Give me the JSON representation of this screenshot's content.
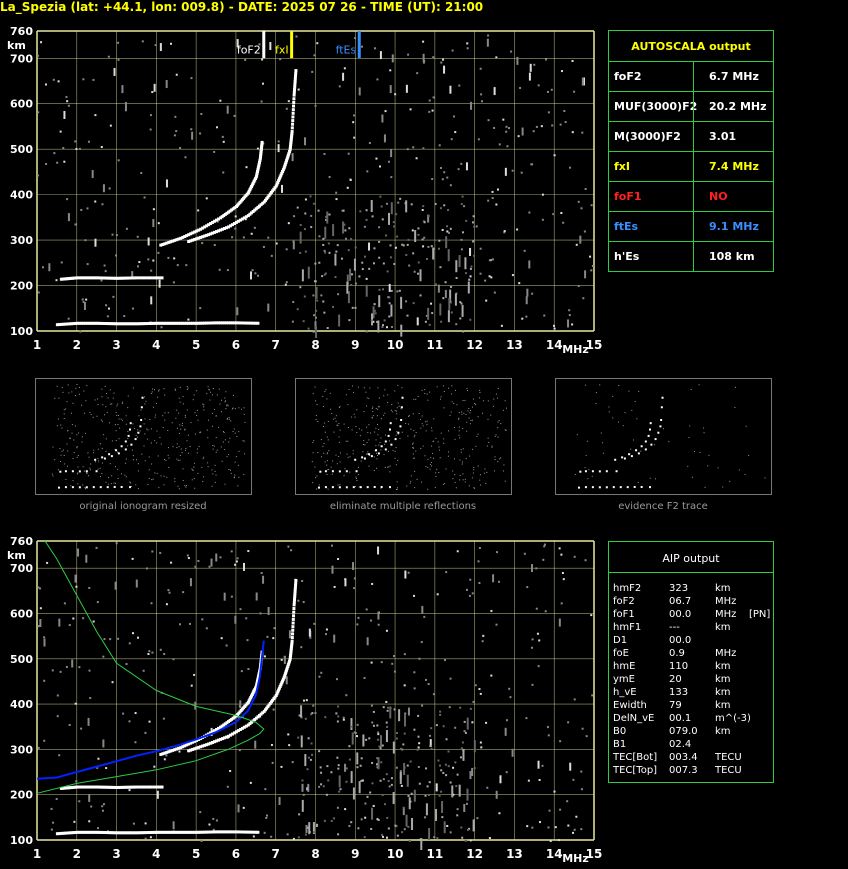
{
  "title": "La_Spezia (lat: +44.1, lon: 009.8) - DATE: 2025 07 26 - TIME (UT): 21:00",
  "colors": {
    "grid": "#e8e8a0",
    "axis": "#e8e8a0",
    "white": "#ffffff",
    "yellow": "#ffff00",
    "blue": "#3a8fff",
    "red": "#ff2020",
    "green": "#2ecc40",
    "profile": "#0022ff"
  },
  "chart_data": [
    {
      "type": "scatter",
      "title": "",
      "x_unit_label": "MHz",
      "y_unit_label": "km",
      "xlim": [
        1,
        15
      ],
      "ylim": [
        100,
        760
      ],
      "x_ticks": [
        1,
        2,
        3,
        4,
        5,
        6,
        7,
        8,
        9,
        10,
        11,
        12,
        13,
        14,
        15
      ],
      "y_ticks": [
        100,
        200,
        300,
        400,
        500,
        600,
        700,
        760
      ],
      "markers": [
        {
          "label": "foF2",
          "x": 6.7,
          "color": "#ffffff"
        },
        {
          "label": "fxI",
          "x": 7.4,
          "color": "#ffff00"
        },
        {
          "label": "ftEs",
          "x": 9.1,
          "color": "#3a8fff"
        }
      ],
      "traces": [
        {
          "name": "o-trace",
          "points": [
            [
              4.1,
              290
            ],
            [
              4.6,
              305
            ],
            [
              5.1,
              325
            ],
            [
              5.6,
              350
            ],
            [
              6.0,
              375
            ],
            [
              6.3,
              405
            ],
            [
              6.5,
              440
            ],
            [
              6.6,
              480
            ],
            [
              6.65,
              520
            ]
          ]
        },
        {
          "name": "x-trace",
          "points": [
            [
              4.8,
              298
            ],
            [
              5.3,
              313
            ],
            [
              5.8,
              330
            ],
            [
              6.3,
              355
            ],
            [
              6.7,
              385
            ],
            [
              7.0,
              420
            ],
            [
              7.2,
              460
            ],
            [
              7.35,
              500
            ],
            [
              7.4,
              540
            ],
            [
              7.45,
              620
            ],
            [
              7.5,
              680
            ]
          ]
        },
        {
          "name": "Es-layer",
          "points": [
            [
              1.5,
              115
            ],
            [
              2,
              118
            ],
            [
              2.5,
              118
            ],
            [
              3,
              117
            ],
            [
              3.5,
              117
            ],
            [
              4,
              118
            ],
            [
              4.5,
              118
            ],
            [
              5,
              118
            ],
            [
              5.5,
              119
            ],
            [
              6,
              119
            ],
            [
              6.6,
              118
            ]
          ]
        },
        {
          "name": "F-spread",
          "points": [
            [
              1.6,
              215
            ],
            [
              2,
              218
            ],
            [
              2.5,
              218
            ],
            [
              3,
              217
            ],
            [
              3.5,
              218
            ],
            [
              4.2,
              218
            ]
          ]
        }
      ]
    },
    {
      "type": "line",
      "title": "",
      "x_unit_label": "MHz",
      "y_unit_label": "km",
      "xlim": [
        1,
        15
      ],
      "ylim": [
        100,
        760
      ],
      "x_ticks": [
        1,
        2,
        3,
        4,
        5,
        6,
        7,
        8,
        9,
        10,
        11,
        12,
        13,
        14,
        15
      ],
      "y_ticks": [
        100,
        200,
        300,
        400,
        500,
        600,
        700,
        760
      ],
      "series": [
        {
          "name": "",
          "color": "#0022ff",
          "points": [
            [
              1,
              235
            ],
            [
              1.5,
              238
            ],
            [
              2,
              250
            ],
            [
              2.5,
              262
            ],
            [
              3,
              274
            ],
            [
              3.5,
              286
            ],
            [
              4,
              296
            ],
            [
              4.5,
              308
            ],
            [
              5,
              322
            ],
            [
              5.5,
              338
            ],
            [
              6,
              360
            ],
            [
              6.3,
              385
            ],
            [
              6.5,
              420
            ],
            [
              6.6,
              460
            ],
            [
              6.65,
              500
            ],
            [
              6.7,
              540
            ]
          ]
        },
        {
          "name": "",
          "color": "#2ecc40",
          "points": [
            [
              1.0,
              203
            ],
            [
              2,
              225
            ],
            [
              3,
              240
            ],
            [
              4,
              255
            ],
            [
              5,
              275
            ],
            [
              5.8,
              300
            ],
            [
              6.3,
              320
            ],
            [
              6.6,
              335
            ],
            [
              6.7,
              345
            ],
            [
              6.5,
              360
            ],
            [
              6.0,
              375
            ],
            [
              5.0,
              395
            ],
            [
              4.0,
              430
            ],
            [
              3.0,
              490
            ],
            [
              2.5,
              560
            ],
            [
              2.0,
              640
            ],
            [
              1.5,
              720
            ],
            [
              1.2,
              760
            ]
          ]
        }
      ]
    }
  ],
  "autoscala": {
    "heading": "AUTOSCALA output",
    "rows": [
      {
        "label": "foF2",
        "value": "6.7 MHz",
        "color": "#ffffff"
      },
      {
        "label": "MUF(3000)F2",
        "value": "20.2 MHz",
        "color": "#ffffff"
      },
      {
        "label": "M(3000)F2",
        "value": "3.01",
        "color": "#ffffff"
      },
      {
        "label": "fxI",
        "value": "7.4 MHz",
        "color": "#ffff00"
      },
      {
        "label": "foF1",
        "value": "NO",
        "color": "#ff2020"
      },
      {
        "label": "ftEs",
        "value": "9.1 MHz",
        "color": "#3a8fff"
      },
      {
        "label": "h'Es",
        "value": "108     km",
        "color": "#ffffff"
      }
    ]
  },
  "thumbnails": [
    {
      "caption": "original ionogram resized"
    },
    {
      "caption": "eliminate multiple reflections"
    },
    {
      "caption": "evidence F2 trace"
    }
  ],
  "aip": {
    "heading": "AIP output",
    "rows": [
      {
        "name": "hmF2",
        "value": "323",
        "unit": "km",
        "extra": ""
      },
      {
        "name": "foF2",
        "value": "06.7",
        "unit": "MHz",
        "extra": ""
      },
      {
        "name": "foF1",
        "value": "00.0",
        "unit": "MHz",
        "extra": "[PN]"
      },
      {
        "name": "hmF1",
        "value": "---",
        "unit": "km",
        "extra": ""
      },
      {
        "name": "D1",
        "value": "00.0",
        "unit": "",
        "extra": ""
      },
      {
        "name": "foE",
        "value": "0.9",
        "unit": "MHz",
        "extra": ""
      },
      {
        "name": "hmE",
        "value": "110",
        "unit": "km",
        "extra": ""
      },
      {
        "name": "ymE",
        "value": "20",
        "unit": "km",
        "extra": ""
      },
      {
        "name": "h_vE",
        "value": "133",
        "unit": "km",
        "extra": ""
      },
      {
        "name": "Ewidth",
        "value": "79",
        "unit": "km",
        "extra": ""
      },
      {
        "name": "DelN_vE",
        "value": "00.1",
        "unit": "m^(-3)",
        "extra": ""
      },
      {
        "name": "B0",
        "value": "079.0",
        "unit": "km",
        "extra": ""
      },
      {
        "name": "B1",
        "value": "02.4",
        "unit": "",
        "extra": ""
      },
      {
        "name": "TEC[Bot]",
        "value": "003.4",
        "unit": "TECU",
        "extra": ""
      },
      {
        "name": "TEC[Top]",
        "value": "007.3",
        "unit": "TECU",
        "extra": ""
      }
    ]
  }
}
